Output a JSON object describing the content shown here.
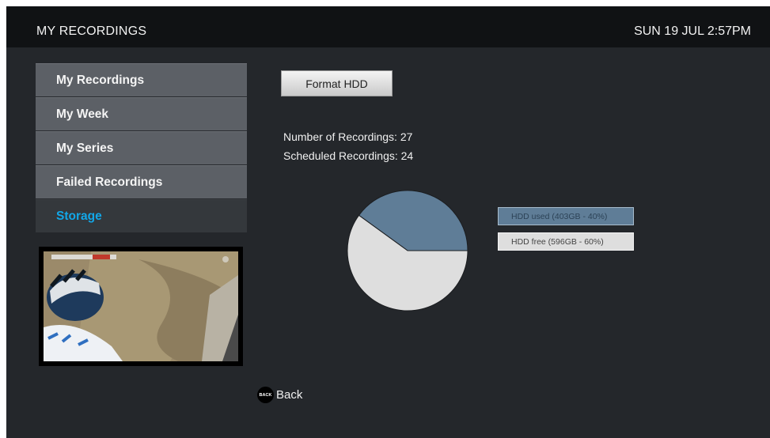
{
  "header": {
    "title": "MY RECORDINGS",
    "clock": "SUN 19 JUL 2:57PM"
  },
  "sidebar": {
    "items": [
      {
        "label": "My Recordings",
        "selected": false
      },
      {
        "label": "My Week",
        "selected": false
      },
      {
        "label": "My Series",
        "selected": false
      },
      {
        "label": "Failed Recordings",
        "selected": false
      },
      {
        "label": "Storage",
        "selected": true
      }
    ]
  },
  "main": {
    "format_button_label": "Format HDD",
    "recordings_count": "Number of Recordings: 27",
    "scheduled_count": "Scheduled Recordings: 24"
  },
  "storage": {
    "legend": [
      {
        "label": "HDD used (403GB - 40%)",
        "color": "#5f7d97"
      },
      {
        "label": "HDD free (596GB - 60%)",
        "color": "#dedede"
      }
    ]
  },
  "chart_data": {
    "type": "pie",
    "slices": [
      {
        "label": "HDD used",
        "value": 40,
        "color": "#5f7d97"
      },
      {
        "label": "HDD free",
        "value": 60,
        "color": "#dedede"
      }
    ]
  },
  "footer": {
    "back_icon_text": "BACK",
    "back_label": "Back"
  },
  "colors": {
    "accent": "#12a7e8",
    "background": "#24272b",
    "topbar": "#101214"
  }
}
